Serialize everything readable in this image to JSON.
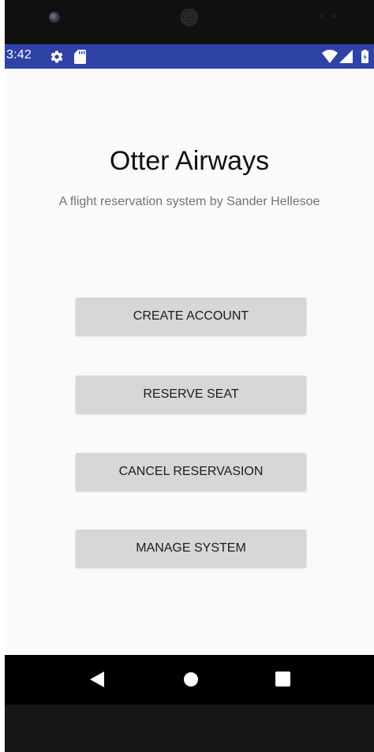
{
  "status_bar": {
    "time": "3:42",
    "color": "#2f42a6",
    "left_icons": [
      "settings-gear-icon",
      "sd-card-icon"
    ],
    "right_icons": [
      "wifi-icon",
      "cellular-signal-icon",
      "battery-icon"
    ]
  },
  "app": {
    "title": "Otter Airways",
    "subtitle": "A flight reservation system by Sander Hellesoe"
  },
  "buttons": [
    {
      "id": "create-account",
      "label": "CREATE ACCOUNT"
    },
    {
      "id": "reserve-seat",
      "label": "RESERVE SEAT"
    },
    {
      "id": "cancel-reservation",
      "label": "CANCEL RESERVASION"
    },
    {
      "id": "manage-system",
      "label": "MANAGE SYSTEM"
    }
  ],
  "nav_bar": {
    "keys": [
      "back-triangle-icon",
      "home-circle-icon",
      "recents-square-icon"
    ]
  },
  "colors": {
    "screen_background": "#fafafa",
    "button_background": "#d6d7d7",
    "nav_bar": "#000000"
  }
}
